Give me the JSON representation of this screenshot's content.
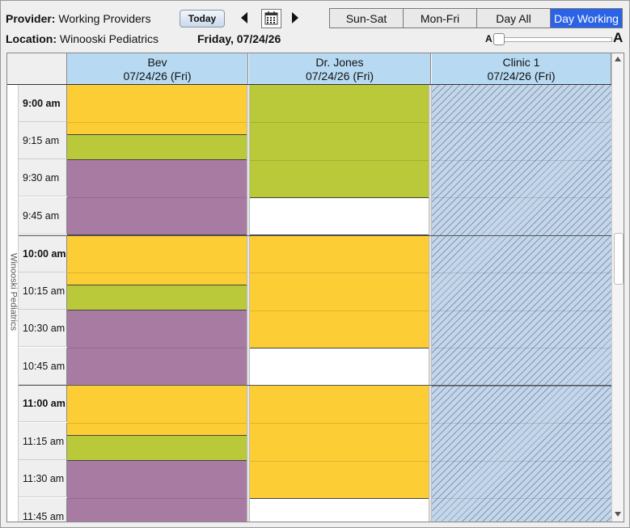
{
  "toolbar": {
    "provider_label": "Provider:",
    "provider_value": "Working Providers",
    "location_label": "Location:",
    "location_value": "Winooski Pediatrics",
    "today_button": "Today",
    "current_date": "Friday, 07/24/26",
    "view_tabs": [
      "Sun-Sat",
      "Mon-Fri",
      "Day All",
      "Day Working"
    ],
    "active_view": "Day Working",
    "font_small": "A",
    "font_large": "A",
    "font_size_level": 0
  },
  "grid": {
    "location_vertical_label": "Winooski Pediatrics",
    "columns": [
      {
        "name": "Bev",
        "date": "07/24/26 (Fri)"
      },
      {
        "name": "Dr. Jones",
        "date": "07/24/26 (Fri)"
      },
      {
        "name": "Clinic 1",
        "date": "07/24/26 (Fri)"
      }
    ],
    "time_slots": [
      "9:00 am",
      "9:15 am",
      "9:30 am",
      "9:45 am",
      "10:00 am",
      "10:15 am",
      "10:30 am",
      "10:45 am",
      "11:00 am",
      "11:15 am",
      "11:30 am",
      "11:45 am"
    ],
    "colors": {
      "yellow": "#fccd34",
      "green": "#b9c93a",
      "purple": "#a87ba3",
      "header": "#b7daf2",
      "active_tab": "#2b63e6",
      "unavailable_hatch": "#c4d6e9"
    }
  }
}
